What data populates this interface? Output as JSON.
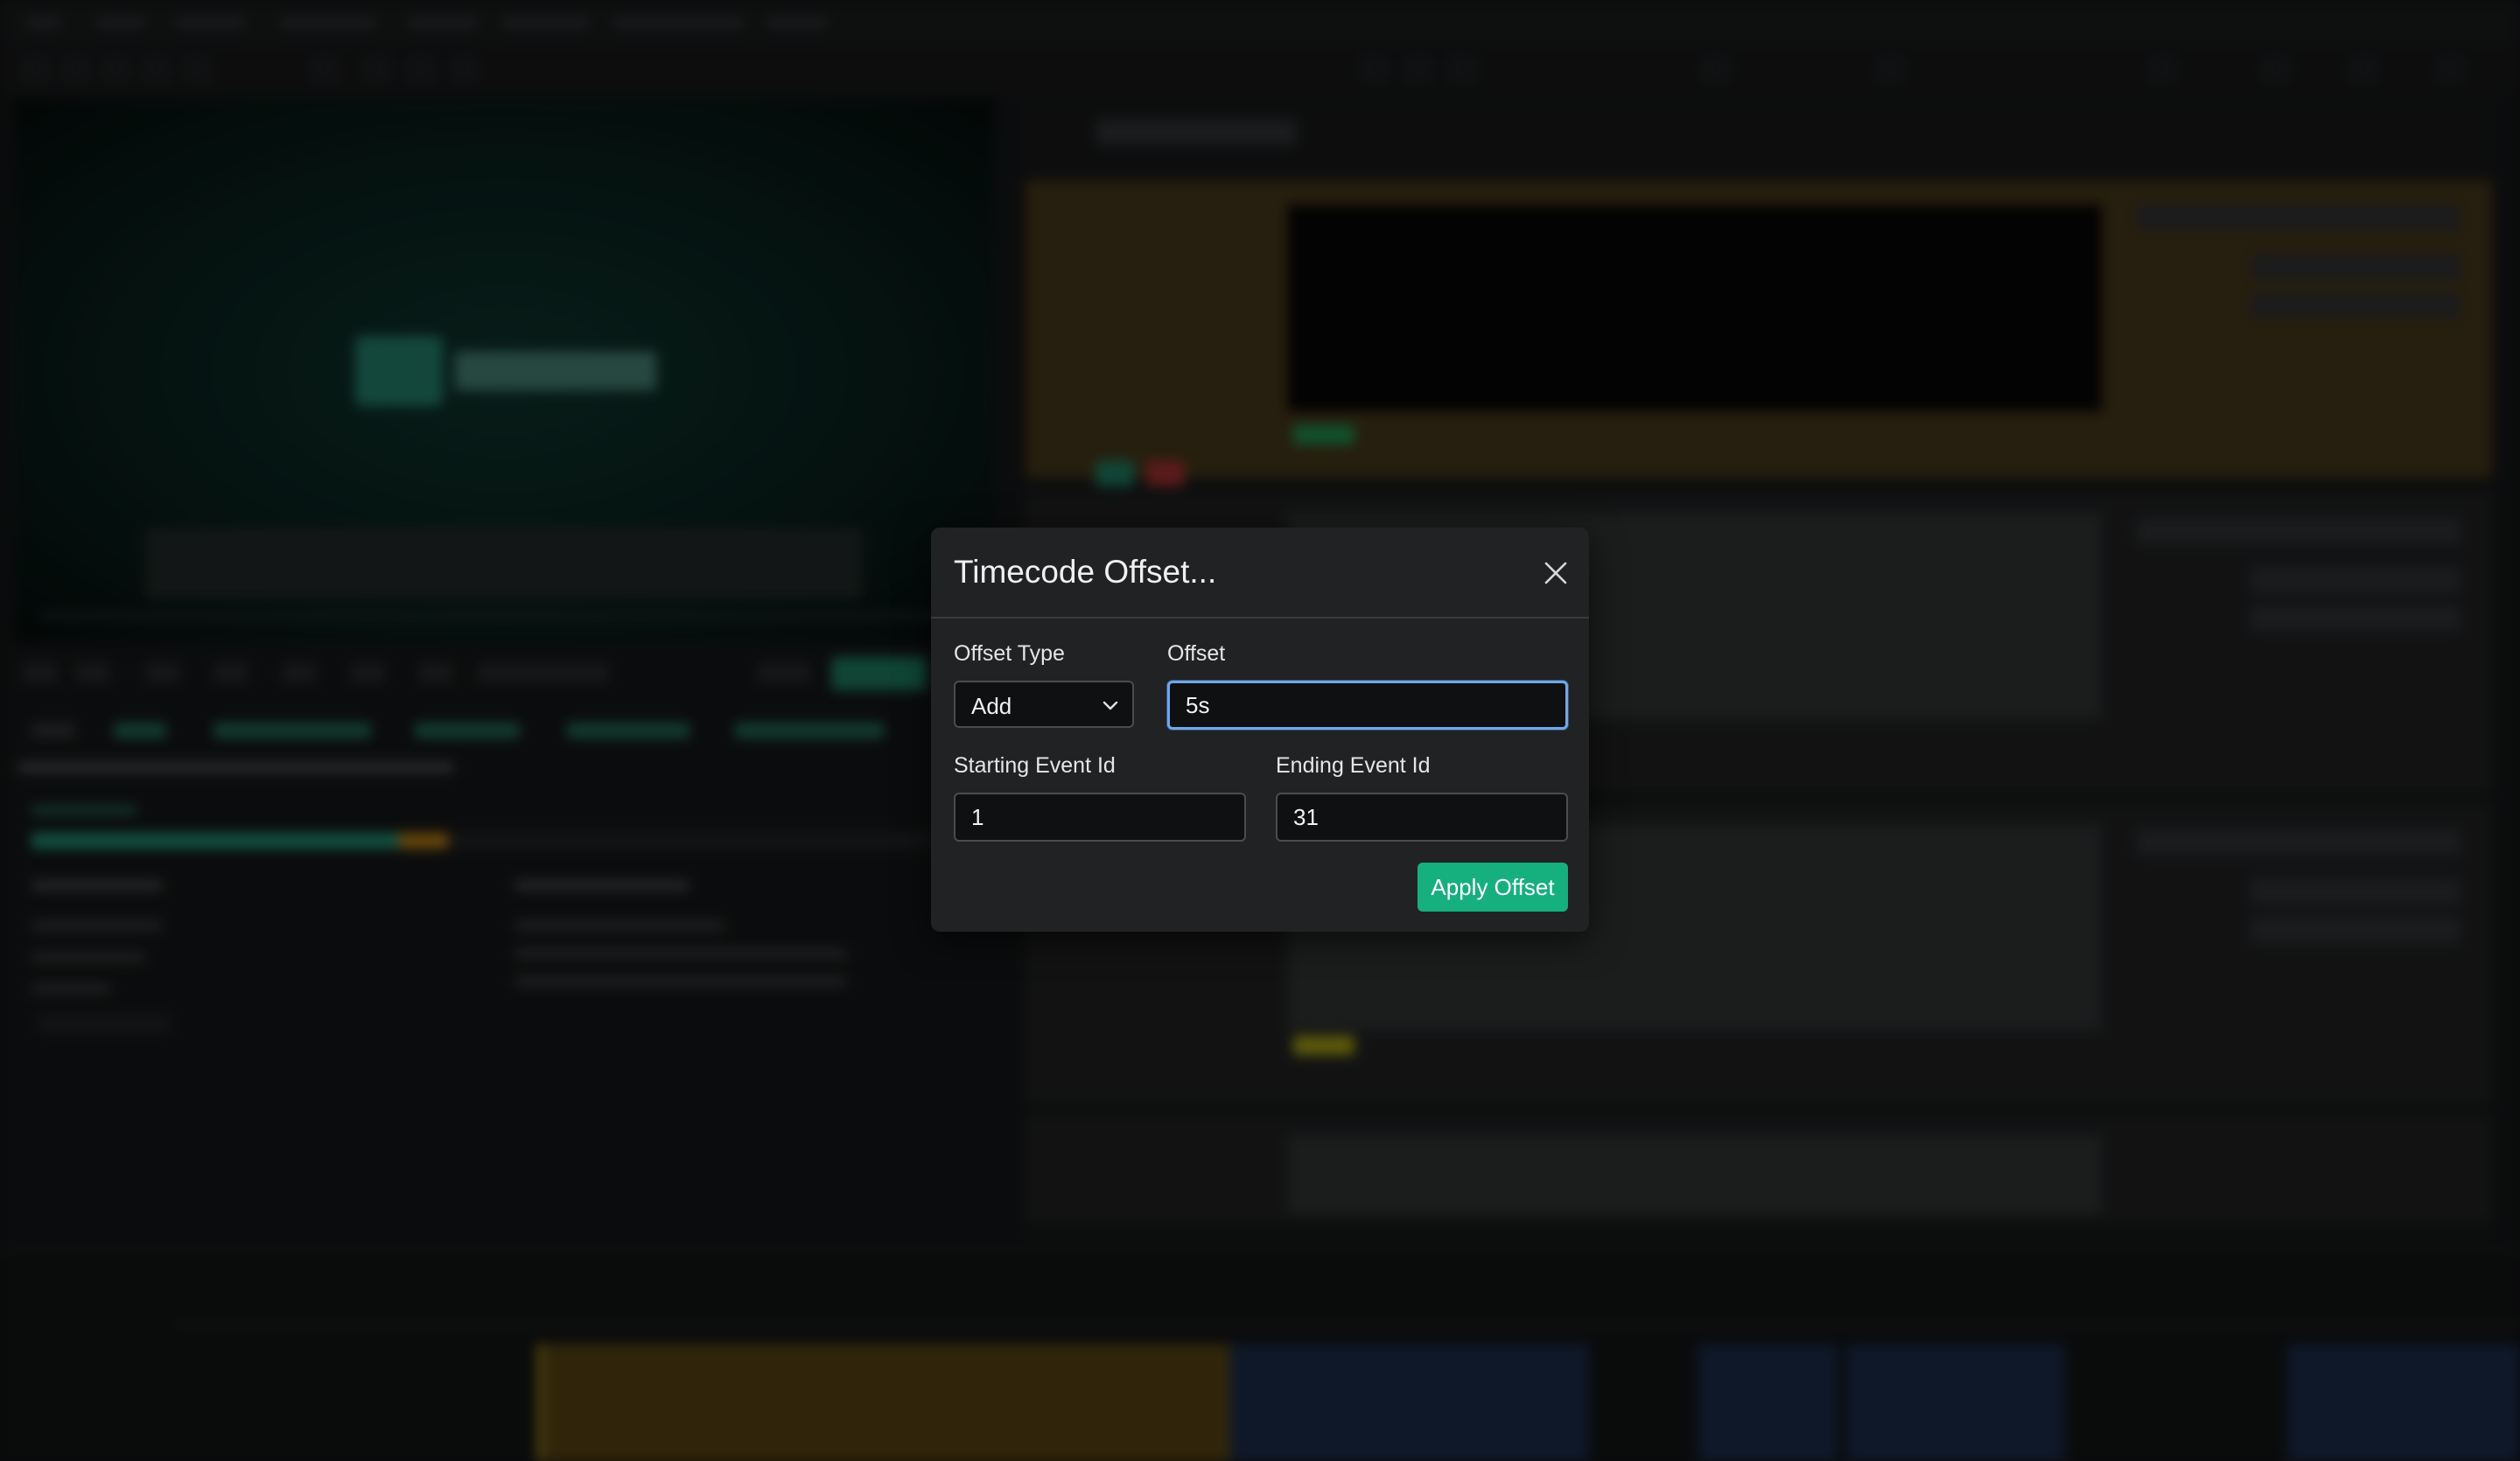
{
  "dialog": {
    "title": "Timecode Offset...",
    "fields": {
      "offset_type": {
        "label": "Offset Type",
        "value": "Add"
      },
      "offset": {
        "label": "Offset",
        "value": "5s"
      },
      "starting_event_id": {
        "label": "Starting Event Id",
        "value": "1"
      },
      "ending_event_id": {
        "label": "Ending Event Id",
        "value": "31"
      }
    },
    "apply_label": "Apply Offset"
  },
  "icons": {
    "close": "close-icon",
    "dropdown": "chevron-down-icon"
  },
  "colors": {
    "accent": "#16b07f",
    "focus_ring": "#6fa8e8",
    "dialog_bg": "#212223"
  }
}
